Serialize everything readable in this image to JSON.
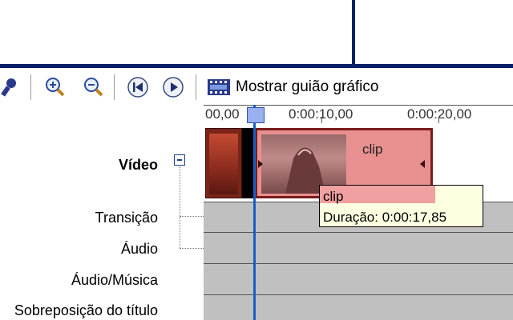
{
  "toolbar": {
    "buttons": [
      {
        "name": "zoom-in",
        "icon": "zoom-in-icon"
      },
      {
        "name": "zoom-out",
        "icon": "zoom-out-icon"
      },
      {
        "name": "rewind",
        "icon": "rewind-icon"
      },
      {
        "name": "play",
        "icon": "play-icon"
      }
    ],
    "storyboard_label": "Mostrar guião gráfico"
  },
  "ruler": {
    "ticks": [
      "00,00",
      "0:00:10,00",
      "0:00:20,00"
    ]
  },
  "tracks": {
    "video": "Vídeo",
    "transition": "Transição",
    "audio": "Áudio",
    "audio_music": "Áudio/Música",
    "title_overlay": "Sobreposição do título"
  },
  "clips": [
    {
      "name": "clip"
    }
  ],
  "tooltip": {
    "name": "clip",
    "duration": "Duração:  0:00:17,85"
  },
  "colors": {
    "border_accent": "#0b1f6b",
    "playhead": "#1560c8",
    "selected_clip": "#e89090",
    "tooltip_bg": "#ffffe1"
  }
}
